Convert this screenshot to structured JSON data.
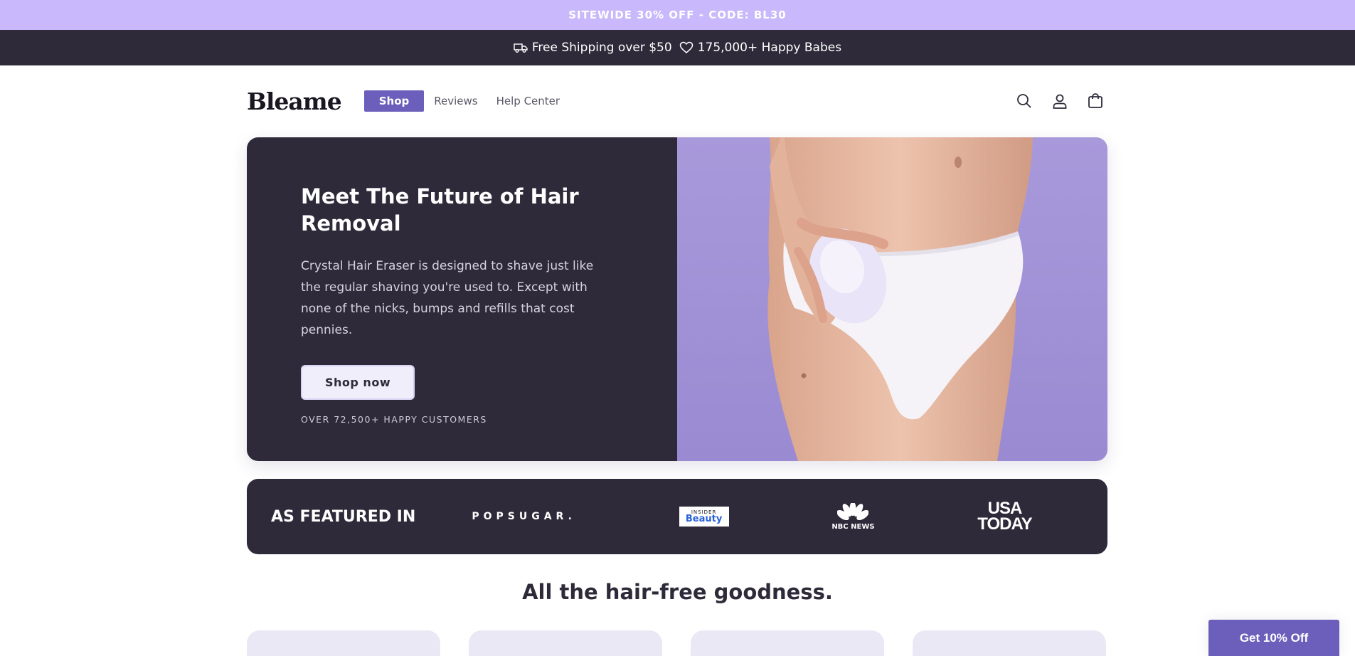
{
  "promo": {
    "text": "SITEWIDE 30% OFF - CODE: BL30"
  },
  "info_bar": {
    "shipping": "Free Shipping over $50",
    "customers": "175,000+ Happy Babes"
  },
  "header": {
    "logo": "Bleame",
    "nav": {
      "shop": "Shop",
      "reviews": "Reviews",
      "help": "Help Center"
    }
  },
  "hero": {
    "title": "Meet The Future of Hair Removal",
    "description": "Crystal Hair Eraser is designed to shave just like the regular shaving you're used to. Except with none of the nicks, bumps and refills that cost pennies.",
    "button": "Shop now",
    "note": "OVER 72,500+ HAPPY CUSTOMERS"
  },
  "featured": {
    "label": "AS FEATURED IN",
    "logos": {
      "popsugar": "POPSUGAR.",
      "insider_top": "INSIDER",
      "insider_bottom": "Beauty",
      "nbc": "NBC NEWS",
      "usa_line1": "USA",
      "usa_line2": "TODAY"
    }
  },
  "section": {
    "title": "All the hair-free goodness."
  },
  "popup": {
    "discount": "Get 10% Off"
  },
  "colors": {
    "promo_bg": "#c9b8fb",
    "dark": "#2e2a39",
    "accent": "#6b5fbb",
    "hero_image_bg": "#a899db",
    "card_bg": "#ebe8f5"
  }
}
